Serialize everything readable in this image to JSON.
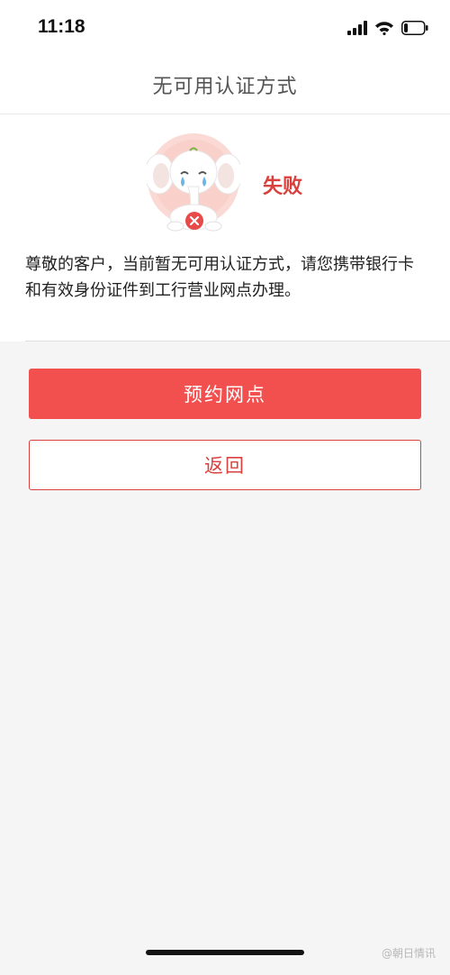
{
  "status_bar": {
    "time": "11:18",
    "icons": [
      "signal-icon",
      "wifi-icon",
      "battery-icon"
    ],
    "battery_level": 0.2
  },
  "nav": {
    "title": "无可用认证方式"
  },
  "result": {
    "status_label": "失败",
    "message": "尊敬的客户，当前暂无可用认证方式，请您携带银行卡和有效身份证件到工行营业网点办理。",
    "icon": "crying-elephant-fail-icon"
  },
  "actions": {
    "primary_label": "预约网点",
    "secondary_label": "返回"
  },
  "watermark": {
    "text": "@朝日情讯"
  },
  "colors": {
    "accent": "#f2504f",
    "accent_text": "#d9413e",
    "background": "#f5f5f5"
  }
}
